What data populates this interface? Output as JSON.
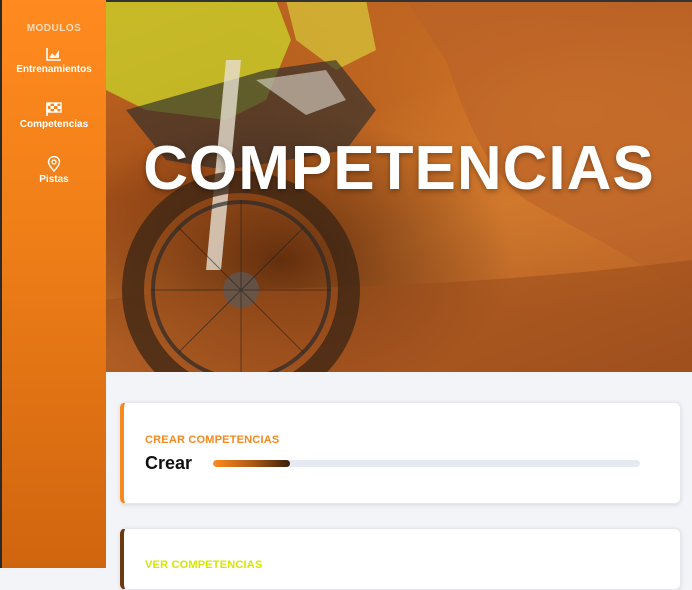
{
  "sidebar": {
    "heading": "MODULOS",
    "items": [
      {
        "label": "Entrenamientos",
        "icon": "chart-icon"
      },
      {
        "label": "Competencias",
        "icon": "checkered-flag-icon"
      },
      {
        "label": "Pistas",
        "icon": "map-pin-icon"
      }
    ]
  },
  "hero": {
    "title": "COMPETENCIAS"
  },
  "cards": [
    {
      "kicker": "CREAR COMPETENCIAS",
      "title": "Crear",
      "progress": 0.18
    },
    {
      "kicker": "VER COMPETENCIAS"
    }
  ],
  "colors": {
    "accent": "#f7891f",
    "sidebar_bottom": "#d0650f",
    "card2_accent": "#6b3a13",
    "card2_kicker": "#d6e600"
  }
}
